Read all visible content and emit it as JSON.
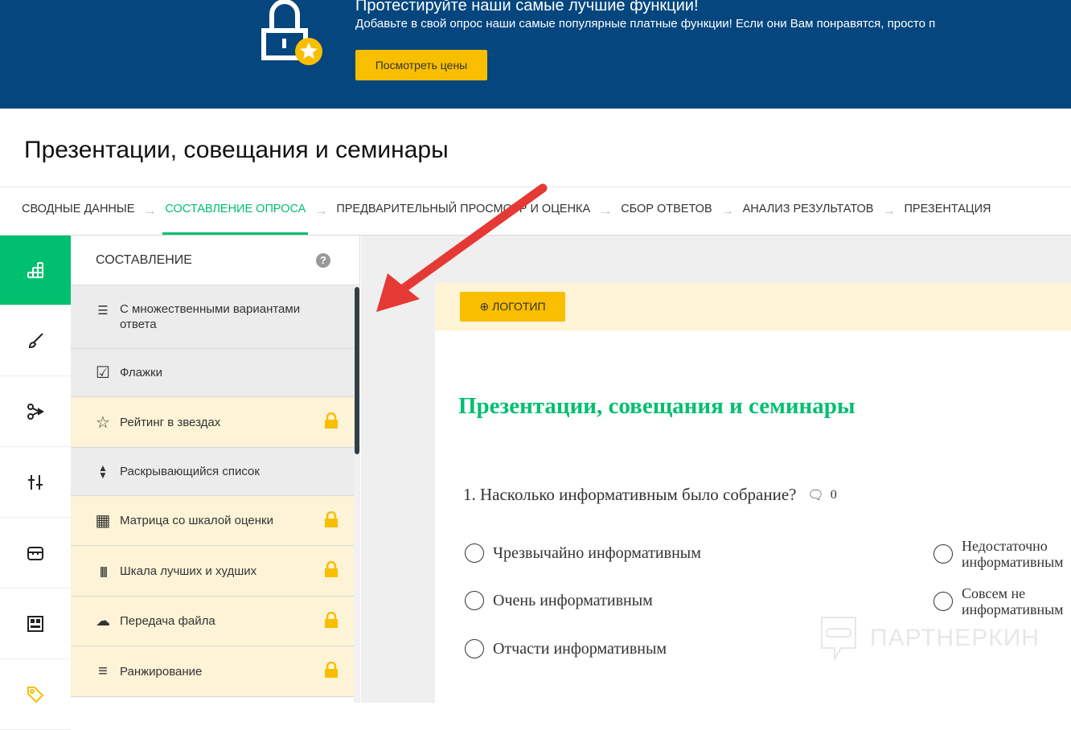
{
  "banner": {
    "heading": "Протестируйте наши самые лучшие функции!",
    "text": "Добавьте в свой опрос наши самые популярные платные функции! Если они Вам понравятся, просто п",
    "button": "Посмотреть цены"
  },
  "page_title": "Презентации, совещания и семинары",
  "nav": {
    "tabs": [
      "СВОДНЫЕ ДАННЫЕ",
      "СОСТАВЛЕНИЕ ОПРОСА",
      "ПРЕДВАРИТЕЛЬНЫЙ ПРОСМОТР И ОЦЕНКА",
      "СБОР ОТВЕТОВ",
      "АНАЛИЗ РЕЗУЛЬТАТОВ",
      "ПРЕЗЕНТАЦИЯ"
    ],
    "active": 1
  },
  "panel": {
    "title": "СОСТАВЛЕНИЕ",
    "help": "?",
    "items": [
      {
        "label": "С множественными вариантами ответа",
        "icon": "list-icon",
        "paid": false
      },
      {
        "label": "Флажки",
        "icon": "checkbox-icon",
        "paid": false
      },
      {
        "label": "Рейтинг в звездах",
        "icon": "star-icon",
        "paid": true
      },
      {
        "label": "Раскрывающийся список",
        "icon": "dropdown-icon",
        "paid": false
      },
      {
        "label": "Матрица со шкалой оценки",
        "icon": "grid-icon",
        "paid": true
      },
      {
        "label": "Шкала лучших и худших",
        "icon": "bars-icon",
        "paid": true
      },
      {
        "label": "Передача файла",
        "icon": "upload-icon",
        "paid": true
      },
      {
        "label": "Ранжирование",
        "icon": "lines-icon",
        "paid": true
      }
    ]
  },
  "survey": {
    "logo_button": "⊕ ЛОГОТИП",
    "title": "Презентации, совещания и семинары",
    "question": "1. Насколько информативным было собрание?",
    "comments": "0",
    "options": [
      "Чрезвычайно информативным",
      "Очень информативным",
      "Отчасти информативным",
      "Недостаточно информативным",
      "Совсем не информативным"
    ]
  },
  "watermark": "ПАРТНЕРКИН",
  "colors": {
    "accent": "#00bf6f",
    "banner": "#05467e",
    "button": "#f9be00",
    "arrow": "#e53935"
  }
}
